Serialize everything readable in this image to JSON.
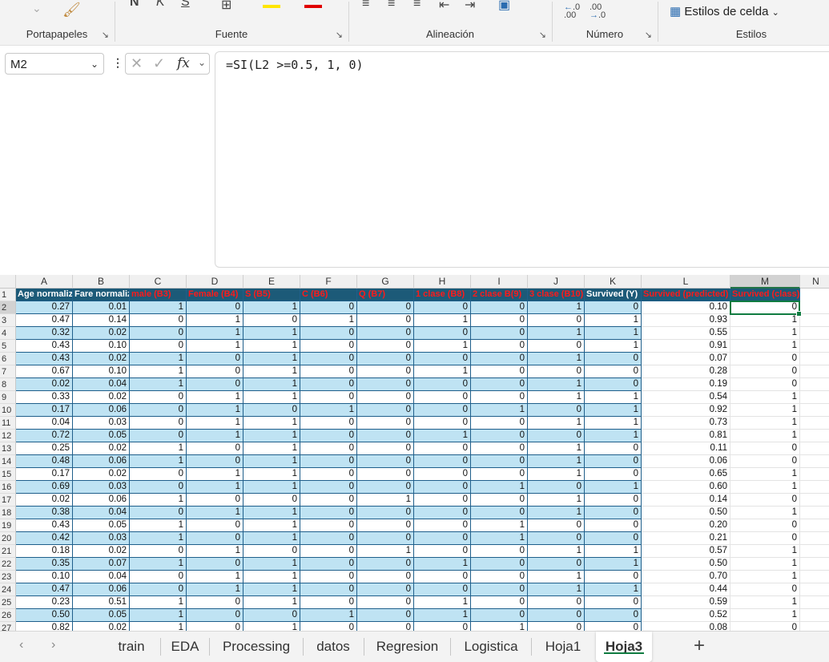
{
  "ribbon": {
    "groups": [
      {
        "label": "Portapapeles"
      },
      {
        "label": "Fuente"
      },
      {
        "label": "Alineación"
      },
      {
        "label": "Número"
      },
      {
        "label": "Estilos"
      }
    ],
    "styles_button_label": "Estilos de celda",
    "number_decrease_label": ".00",
    "number_increase_label": ".0"
  },
  "formula_bar": {
    "name_box": "M2",
    "formula": "=SI(L2 >=0.5, 1, 0)"
  },
  "grid": {
    "columns": [
      "A",
      "B",
      "C",
      "D",
      "E",
      "F",
      "G",
      "H",
      "I",
      "J",
      "K",
      "L",
      "M",
      "N"
    ],
    "selected_column": "M",
    "selected_row": "2",
    "header_row": [
      "Age normaliz",
      "Fare normaliz",
      "male (B3)",
      "Female (B4)",
      "S (B5)",
      "C (B6)",
      "Q (B7)",
      "1 clase (B8)",
      "2 clase B(9)",
      "3 clase (B10)",
      "Survived (Y)",
      "Survived (predicted)",
      "Survived (class)"
    ],
    "rows": [
      {
        "n": "2",
        "v": [
          "0.27",
          "0.01",
          "1",
          "0",
          "1",
          "0",
          "0",
          "0",
          "0",
          "1",
          "0",
          "0.10",
          "0"
        ]
      },
      {
        "n": "3",
        "v": [
          "0.47",
          "0.14",
          "0",
          "1",
          "0",
          "1",
          "0",
          "1",
          "0",
          "0",
          "1",
          "0.93",
          "1"
        ]
      },
      {
        "n": "4",
        "v": [
          "0.32",
          "0.02",
          "0",
          "1",
          "1",
          "0",
          "0",
          "0",
          "0",
          "1",
          "1",
          "0.55",
          "1"
        ]
      },
      {
        "n": "5",
        "v": [
          "0.43",
          "0.10",
          "0",
          "1",
          "1",
          "0",
          "0",
          "1",
          "0",
          "0",
          "1",
          "0.91",
          "1"
        ]
      },
      {
        "n": "6",
        "v": [
          "0.43",
          "0.02",
          "1",
          "0",
          "1",
          "0",
          "0",
          "0",
          "0",
          "1",
          "0",
          "0.07",
          "0"
        ]
      },
      {
        "n": "7",
        "v": [
          "0.67",
          "0.10",
          "1",
          "0",
          "1",
          "0",
          "0",
          "1",
          "0",
          "0",
          "0",
          "0.28",
          "0"
        ]
      },
      {
        "n": "8",
        "v": [
          "0.02",
          "0.04",
          "1",
          "0",
          "1",
          "0",
          "0",
          "0",
          "0",
          "1",
          "0",
          "0.19",
          "0"
        ]
      },
      {
        "n": "9",
        "v": [
          "0.33",
          "0.02",
          "0",
          "1",
          "1",
          "0",
          "0",
          "0",
          "0",
          "1",
          "1",
          "0.54",
          "1"
        ]
      },
      {
        "n": "10",
        "v": [
          "0.17",
          "0.06",
          "0",
          "1",
          "0",
          "1",
          "0",
          "0",
          "1",
          "0",
          "1",
          "0.92",
          "1"
        ]
      },
      {
        "n": "11",
        "v": [
          "0.04",
          "0.03",
          "0",
          "1",
          "1",
          "0",
          "0",
          "0",
          "0",
          "1",
          "1",
          "0.73",
          "1"
        ]
      },
      {
        "n": "12",
        "v": [
          "0.72",
          "0.05",
          "0",
          "1",
          "1",
          "0",
          "0",
          "1",
          "0",
          "0",
          "1",
          "0.81",
          "1"
        ]
      },
      {
        "n": "13",
        "v": [
          "0.25",
          "0.02",
          "1",
          "0",
          "1",
          "0",
          "0",
          "0",
          "0",
          "1",
          "0",
          "0.11",
          "0"
        ]
      },
      {
        "n": "14",
        "v": [
          "0.48",
          "0.06",
          "1",
          "0",
          "1",
          "0",
          "0",
          "0",
          "0",
          "1",
          "0",
          "0.06",
          "0"
        ]
      },
      {
        "n": "15",
        "v": [
          "0.17",
          "0.02",
          "0",
          "1",
          "1",
          "0",
          "0",
          "0",
          "0",
          "1",
          "0",
          "0.65",
          "1"
        ]
      },
      {
        "n": "16",
        "v": [
          "0.69",
          "0.03",
          "0",
          "1",
          "1",
          "0",
          "0",
          "0",
          "1",
          "0",
          "1",
          "0.60",
          "1"
        ]
      },
      {
        "n": "17",
        "v": [
          "0.02",
          "0.06",
          "1",
          "0",
          "0",
          "0",
          "1",
          "0",
          "0",
          "1",
          "0",
          "0.14",
          "0"
        ]
      },
      {
        "n": "18",
        "v": [
          "0.38",
          "0.04",
          "0",
          "1",
          "1",
          "0",
          "0",
          "0",
          "0",
          "1",
          "0",
          "0.50",
          "1"
        ]
      },
      {
        "n": "19",
        "v": [
          "0.43",
          "0.05",
          "1",
          "0",
          "1",
          "0",
          "0",
          "0",
          "1",
          "0",
          "0",
          "0.20",
          "0"
        ]
      },
      {
        "n": "20",
        "v": [
          "0.42",
          "0.03",
          "1",
          "0",
          "1",
          "0",
          "0",
          "0",
          "1",
          "0",
          "0",
          "0.21",
          "0"
        ]
      },
      {
        "n": "21",
        "v": [
          "0.18",
          "0.02",
          "0",
          "1",
          "0",
          "0",
          "1",
          "0",
          "0",
          "1",
          "1",
          "0.57",
          "1"
        ]
      },
      {
        "n": "22",
        "v": [
          "0.35",
          "0.07",
          "1",
          "0",
          "1",
          "0",
          "0",
          "1",
          "0",
          "0",
          "1",
          "0.50",
          "1"
        ]
      },
      {
        "n": "23",
        "v": [
          "0.10",
          "0.04",
          "0",
          "1",
          "1",
          "0",
          "0",
          "0",
          "0",
          "1",
          "0",
          "0.70",
          "1"
        ]
      },
      {
        "n": "24",
        "v": [
          "0.47",
          "0.06",
          "0",
          "1",
          "1",
          "0",
          "0",
          "0",
          "0",
          "1",
          "1",
          "0.44",
          "0"
        ]
      },
      {
        "n": "25",
        "v": [
          "0.23",
          "0.51",
          "1",
          "0",
          "1",
          "0",
          "0",
          "1",
          "0",
          "0",
          "0",
          "0.59",
          "1"
        ]
      },
      {
        "n": "26",
        "v": [
          "0.50",
          "0.05",
          "1",
          "0",
          "0",
          "1",
          "0",
          "1",
          "0",
          "0",
          "0",
          "0.52",
          "1"
        ]
      },
      {
        "n": "27",
        "v": [
          "0.82",
          "0.02",
          "1",
          "0",
          "1",
          "0",
          "0",
          "0",
          "1",
          "0",
          "0",
          "0.08",
          "0"
        ]
      }
    ]
  },
  "sheet_tabs": {
    "tabs": [
      "train",
      "EDA",
      "Processing",
      "datos",
      "Regresion",
      "Logistica",
      "Hoja1",
      "Hoja3"
    ],
    "active": "Hoja3",
    "add_label": "+"
  },
  "colors": {
    "table_header": "#1c5a78",
    "band": "#bfe3f3",
    "red_header_text": "#ff1a1a",
    "accent": "#107c41"
  }
}
